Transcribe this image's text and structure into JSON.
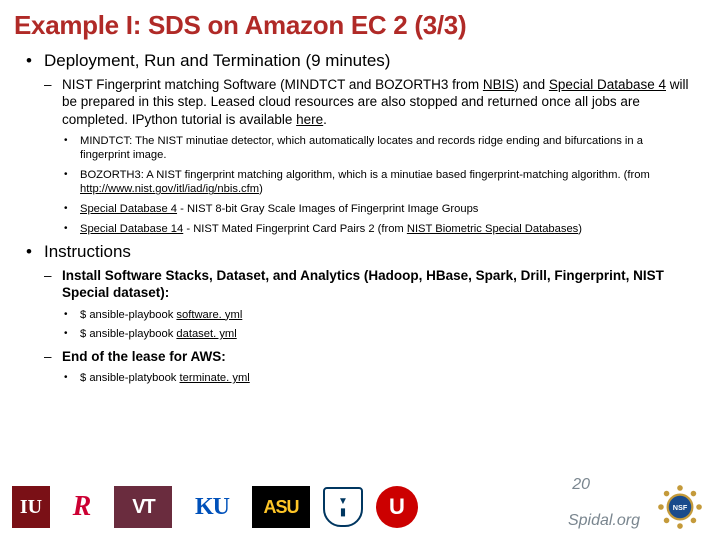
{
  "title": "Example I: SDS on Amazon EC 2 (3/3)",
  "b1": {
    "head": "Deployment, Run and Termination (9 minutes)",
    "p_a": "NIST Fingerprint matching Software (MINDTCT and BOZORTH3 from ",
    "p_b": "NBIS",
    "p_c": ") and ",
    "p_d": "Special Database 4",
    "p_e": " will be prepared in this step. Leased cloud resources are also stopped and returned once all jobs are completed. IPython tutorial is available ",
    "p_f": "here",
    "p_g": ".",
    "s1": "MINDTCT: The NIST minutiae detector, which automatically locates and records ridge ending and bifurcations in a fingerprint image.",
    "s2a": "BOZORTH3: A NIST fingerprint matching algorithm, which is a minutiae based fingerprint-matching algorithm. (from ",
    "s2b": "http://www.nist.gov/itl/iad/ig/nbis.cfm",
    "s2c": ")",
    "s3a": "Special Database 4",
    "s3b": " - NIST 8-bit Gray Scale Images of Fingerprint Image Groups",
    "s4a": "Special Database 14",
    "s4b": " - NIST Mated Fingerprint Card Pairs 2 (from ",
    "s4c": "NIST Biometric Special Databases",
    "s4d": ")"
  },
  "b2": {
    "head": "Instructions",
    "i1": "Install Software Stacks, Dataset, and Analytics (Hadoop, HBase, Spark, Drill, Fingerprint, NIST Special dataset):",
    "c1a": "$  ansible-playbook ",
    "c1b": "software. yml",
    "c2a": "$  ansible-playbook ",
    "c2b": "dataset. yml",
    "i2": "End of the lease for AWS:",
    "c3a": "$  ansible-platybook ",
    "c3b": "terminate. yml"
  },
  "page": "20",
  "site": "Spidal.org",
  "logos": {
    "iu": "IU",
    "rut": "R",
    "vt": "VT",
    "ku": "KU",
    "asu": "ASU",
    "utah": "U"
  }
}
